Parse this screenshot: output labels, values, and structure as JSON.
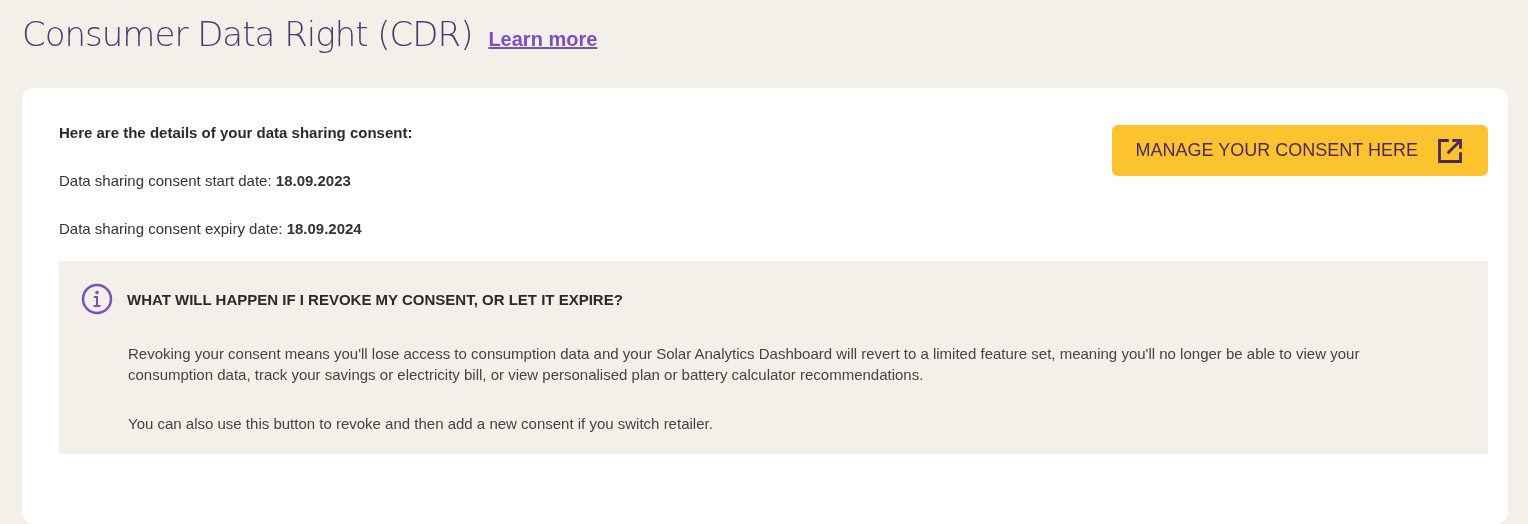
{
  "header": {
    "title": "Consumer Data Right (CDR)",
    "link": "Learn more"
  },
  "consent": {
    "heading": "Here are the details of your data sharing consent:",
    "lines": [
      "Data sharing consent start date: **18.09.2023**",
      "Data sharing consent expiry date: **18.09.2024**"
    ],
    "button": "MANAGE YOUR CONSENT HERE"
  },
  "info": {
    "heading": "WHAT WILL HAPPEN IF I REVOKE MY CONSENT, OR LET IT EXPIRE?",
    "paragraphs": [
      "Revoking your consent means you'll lose access to consumption data and your Solar Analytics Dashboard will revert to a limited feature set, meaning you'll no longer be able to view your consumption data, track your savings or electricity bill, or view personalised plan or battery calculator recommendations.",
      "You can also use this button to revoke and then add a new consent if you switch retailer."
    ]
  }
}
